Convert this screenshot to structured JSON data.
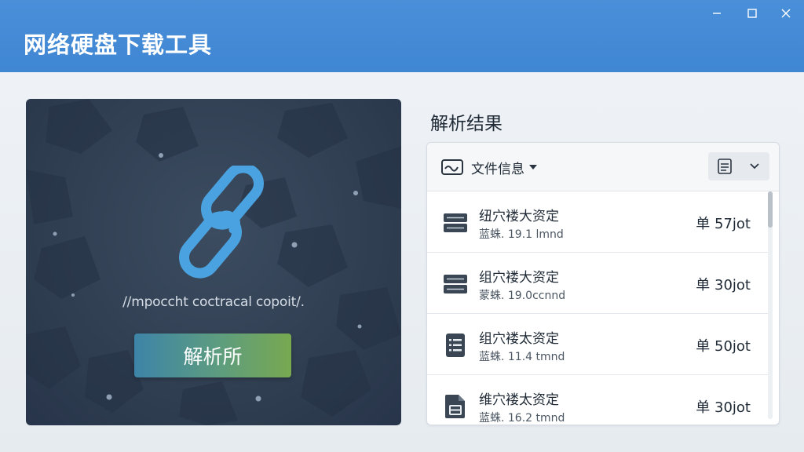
{
  "window": {
    "title": "网络硬盘下载工具",
    "controls": {
      "minimize": "minimize-icon",
      "maximize": "maximize-icon",
      "close": "close-icon"
    }
  },
  "left": {
    "link_icon": "link-icon",
    "url_text": "//mpoccht coctracal copoit/.",
    "parse_button": "解析所"
  },
  "results": {
    "title": "解析结果",
    "header": {
      "dropdown_label": "文件信息",
      "dropdown_icon": "waveform-icon",
      "tool_icon": "document-icon",
      "tool_menu_icon": "chevron-down-icon"
    },
    "rows": [
      {
        "name": "纽穴褛大资定",
        "meta": "蓝蛛. 19.1 lmnd",
        "size": "单 57jot",
        "icon": "server-icon"
      },
      {
        "name": "组穴褛大资定",
        "meta": "蒙蛛. 19.0ccnnd",
        "size": "单 30jot",
        "icon": "server-icon"
      },
      {
        "name": "组穴褛太资定",
        "meta": "蓝蛛. 11.4 tmnd",
        "size": "单 50jot",
        "icon": "list-document-icon"
      },
      {
        "name": "维穴褛太资定",
        "meta": "蓝蛛. 16.2 tmnd",
        "size": "单 30jot",
        "icon": "file-icon"
      }
    ]
  },
  "colors": {
    "titlebar": "#4a8fd8",
    "panel_dark": "#2e3c4f",
    "link_blue": "#4aa3e0",
    "button_start": "#3d84a8",
    "button_end": "#78a850"
  }
}
